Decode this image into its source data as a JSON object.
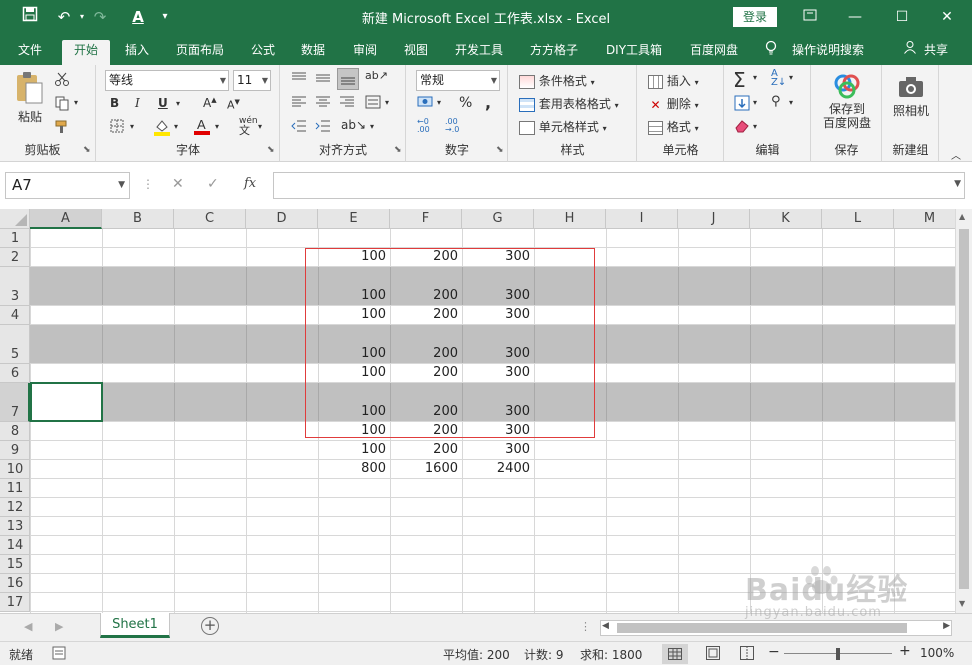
{
  "window": {
    "title": "新建 Microsoft Excel 工作表.xlsx  -  Excel",
    "login_label": "登录"
  },
  "menu_tabs": [
    "文件",
    "开始",
    "插入",
    "页面布局",
    "公式",
    "数据",
    "审阅",
    "视图",
    "开发工具",
    "方方格子",
    "DIY工具箱",
    "百度网盘",
    "操作说明搜索",
    "共享"
  ],
  "ribbon": {
    "clipboard": {
      "paste": "粘贴",
      "label": "剪贴板"
    },
    "font": {
      "name": "等线",
      "size": "11",
      "label": "字体"
    },
    "alignment": {
      "label": "对齐方式"
    },
    "number": {
      "format": "常规",
      "label": "数字"
    },
    "styles": {
      "conditional": "条件格式",
      "table": "套用表格格式",
      "cell": "单元格样式",
      "label": "样式"
    },
    "cells": {
      "insert": "插入",
      "delete": "删除",
      "format": "格式",
      "label": "单元格"
    },
    "editing": {
      "label": "编辑"
    },
    "save": {
      "button": "保存到\n百度网盘",
      "line1": "保存到",
      "line2": "百度网盘",
      "label": "保存"
    },
    "camera": {
      "button": "照相机",
      "label": "新建组"
    }
  },
  "formula_bar": {
    "name_box": "A7",
    "formula": ""
  },
  "columns": [
    "A",
    "B",
    "C",
    "D",
    "E",
    "F",
    "G",
    "H",
    "I",
    "J",
    "K",
    "L",
    "M"
  ],
  "rows": [
    {
      "num": "1",
      "values": [
        "",
        "",
        ""
      ]
    },
    {
      "num": "2",
      "values": [
        "100",
        "200",
        "300"
      ]
    },
    {
      "num": "3",
      "values": [
        "100",
        "200",
        "300"
      ]
    },
    {
      "num": "4",
      "values": [
        "100",
        "200",
        "300"
      ]
    },
    {
      "num": "5",
      "values": [
        "100",
        "200",
        "300"
      ]
    },
    {
      "num": "6",
      "values": [
        "100",
        "200",
        "300"
      ]
    },
    {
      "num": "7",
      "values": [
        "100",
        "200",
        "300"
      ]
    },
    {
      "num": "8",
      "values": [
        "100",
        "200",
        "300"
      ]
    },
    {
      "num": "9",
      "values": [
        "100",
        "200",
        "300"
      ]
    },
    {
      "num": "10",
      "values": [
        "800",
        "1600",
        "2400"
      ]
    },
    {
      "num": "11",
      "values": [
        "",
        "",
        ""
      ]
    },
    {
      "num": "12",
      "values": [
        "",
        "",
        ""
      ]
    },
    {
      "num": "13",
      "values": [
        "",
        "",
        ""
      ]
    },
    {
      "num": "14",
      "values": [
        "",
        "",
        ""
      ]
    },
    {
      "num": "15",
      "values": [
        "",
        "",
        ""
      ]
    },
    {
      "num": "16",
      "values": [
        "",
        "",
        ""
      ]
    },
    {
      "num": "17",
      "values": [
        "",
        "",
        ""
      ]
    }
  ],
  "sheet_tab": "Sheet1",
  "status": {
    "mode": "就绪",
    "average": "平均值: 200",
    "count": "计数: 9",
    "sum": "求和: 1800",
    "zoom": "100%"
  },
  "watermark": "Baidu经验 jingyan.baidu.com",
  "colors": {
    "excel_green": "#217346",
    "highlight_gray": "#c0c0c0",
    "selection_red": "#e03c3c"
  }
}
